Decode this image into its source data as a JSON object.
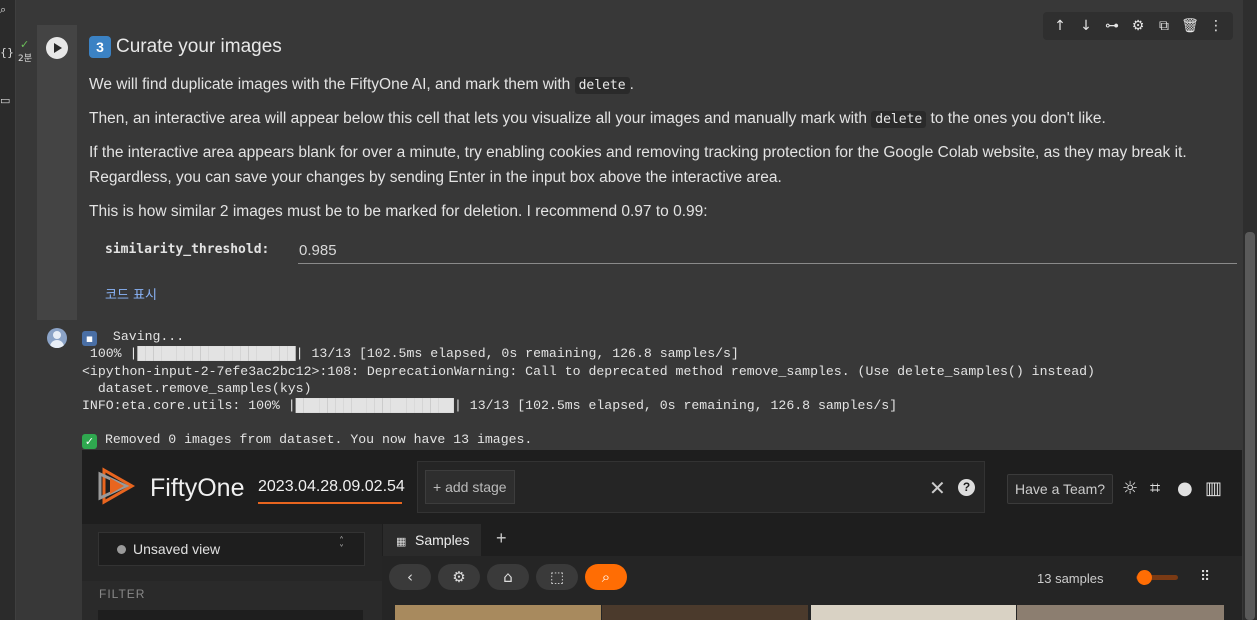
{
  "rail": {
    "icons": [
      "search-icon",
      "variables-icon",
      "files-icon"
    ]
  },
  "cell": {
    "exec_time": "2분",
    "toolbar": [
      "move-up-icon",
      "move-down-icon",
      "link-icon",
      "settings-icon",
      "mirror-icon",
      "delete-icon",
      "more-icon"
    ],
    "title_number": "3",
    "title": "Curate your images",
    "p1_a": "We will find duplicate images with the FiftyOne AI, and mark them with ",
    "p1_code": "delete",
    "p1_b": ".",
    "p2_a": "Then, an interactive area will appear below this cell that lets you visualize all your images and manually mark with ",
    "p2_code": "delete",
    "p2_b": " to the ones you don't like.",
    "p3_line1": "If the interactive area appears blank for over a minute, try enabling cookies and removing tracking protection for the Google Colab website, as they may break it.",
    "p3_line2": "Regardless, you can save your changes by sending Enter in the input box above the interactive area.",
    "p4": "This is how similar 2 images must be to be marked for deletion. I recommend 0.97 to 0.99:",
    "param_label": "similarity_threshold:",
    "param_value": "0.985",
    "show_code": "코드 표시"
  },
  "output": {
    "saving": " Saving...",
    "progress1": " 100% |████████████████████| 13/13 [102.5ms elapsed, 0s remaining, 126.8 samples/s]",
    "warning1": "<ipython-input-2-7efe3ac2bc12>:108: DeprecationWarning: Call to deprecated method remove_samples. (Use delete_samples() instead)",
    "warning2": "  dataset.remove_samples(kys)",
    "info": "INFO:eta.core.utils: 100% |████████████████████| 13/13 [102.5ms elapsed, 0s remaining, 126.8 samples/s]",
    "removed": "Removed 0 images from dataset. You now have 13 images."
  },
  "fiftyone": {
    "brand": "FiftyOne",
    "dataset": "2023.04.28.09.02.54",
    "add_stage": "+ add stage",
    "team": "Have a Team?",
    "view_label": "Unsaved view",
    "filter": "FILTER",
    "tab": "Samples",
    "add_tab": "+",
    "samples_count": "13 samples",
    "accent": "#ff6d04",
    "header_icons": [
      "theme-icon",
      "slack-icon",
      "github-icon",
      "docs-icon"
    ],
    "toolbar_icons": [
      "back-icon",
      "settings-icon",
      "tag-icon",
      "patches-icon",
      "similarity-search-icon"
    ]
  }
}
